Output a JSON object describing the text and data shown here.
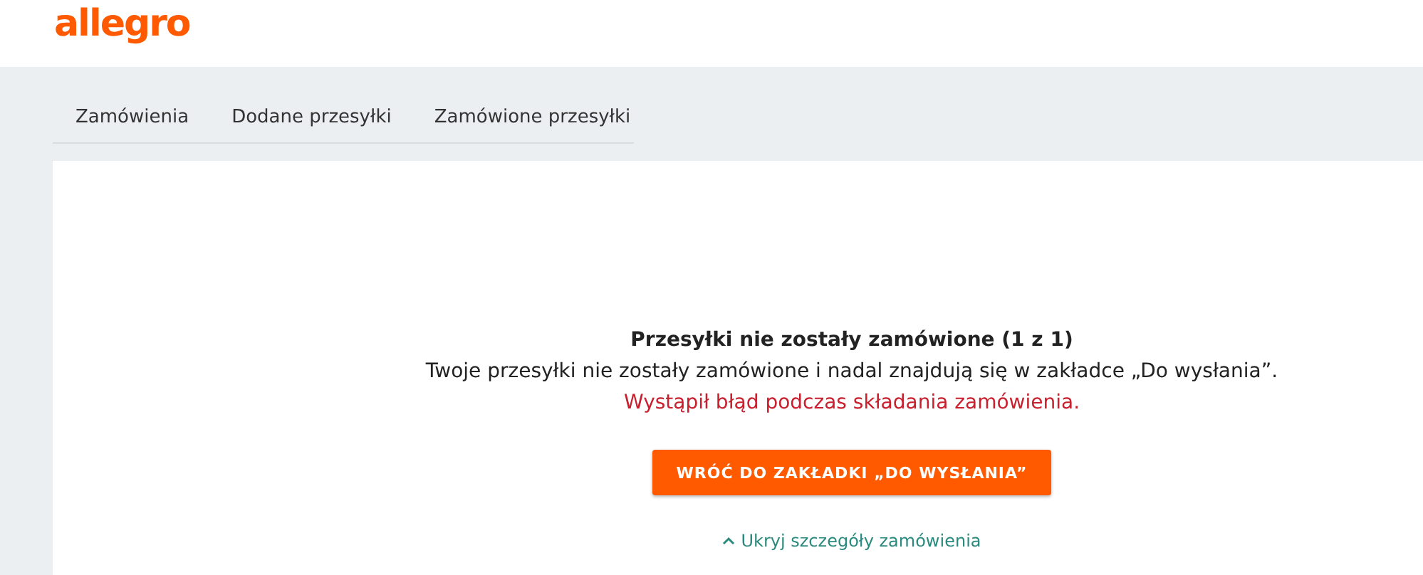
{
  "logo": "allegro",
  "tabs": [
    {
      "label": "Zamówienia"
    },
    {
      "label": "Dodane przesyłki"
    },
    {
      "label": "Zamówione przesyłki"
    }
  ],
  "result": {
    "title": "Przesyłki nie zostały zamówione (1 z 1)",
    "message": "Twoje przesyłki nie zostały zamówione i nadal znajdują się w zakładce „Do wysłania”.",
    "error": "Wystąpił błąd podczas składania zamówienia.",
    "button": "WRÓĆ DO ZAKŁADKI „DO WYSŁANIA”",
    "toggle": "Ukryj szczegóły zamówienia"
  }
}
